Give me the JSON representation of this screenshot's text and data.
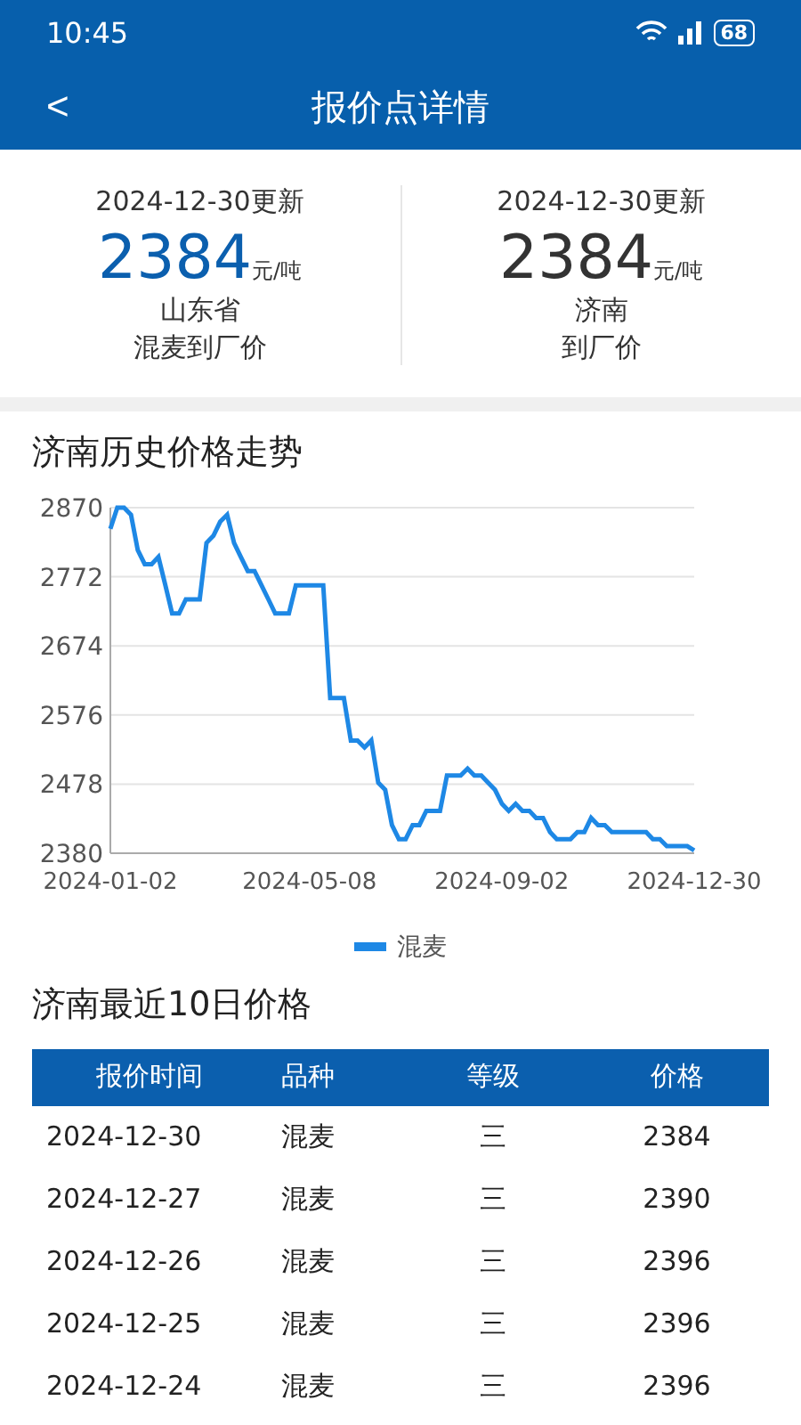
{
  "status_bar": {
    "time": "10:45",
    "battery": "68"
  },
  "header": {
    "back": "<",
    "title": "报价点详情"
  },
  "summary": [
    {
      "updated": "2024-12-30更新",
      "price": "2384",
      "unit": "元/吨",
      "highlight": true,
      "lines": [
        "山东省",
        "混麦到厂价"
      ]
    },
    {
      "updated": "2024-12-30更新",
      "price": "2384",
      "unit": "元/吨",
      "highlight": false,
      "lines": [
        "济南",
        "到厂价"
      ]
    }
  ],
  "history": {
    "title": "济南历史价格走势",
    "chart_data": {
      "type": "line",
      "series": [
        {
          "name": "混麦",
          "color": "#1e88e5",
          "values": [
            2840,
            2870,
            2870,
            2860,
            2810,
            2790,
            2790,
            2800,
            2760,
            2720,
            2720,
            2740,
            2740,
            2740,
            2820,
            2830,
            2850,
            2860,
            2820,
            2800,
            2780,
            2780,
            2760,
            2740,
            2720,
            2720,
            2720,
            2760,
            2760,
            2760,
            2760,
            2760,
            2600,
            2600,
            2600,
            2540,
            2540,
            2530,
            2540,
            2480,
            2470,
            2420,
            2400,
            2400,
            2420,
            2420,
            2440,
            2440,
            2440,
            2490,
            2490,
            2490,
            2500,
            2490,
            2490,
            2480,
            2470,
            2450,
            2440,
            2450,
            2440,
            2440,
            2430,
            2430,
            2410,
            2400,
            2400,
            2400,
            2410,
            2410,
            2430,
            2420,
            2420,
            2410,
            2410,
            2410,
            2410,
            2410,
            2410,
            2400,
            2400,
            2390,
            2390,
            2390,
            2390,
            2384
          ]
        }
      ],
      "ylim": [
        2380,
        2870
      ],
      "yticks": [
        2380,
        2478,
        2576,
        2674,
        2772,
        2870
      ],
      "grid": true,
      "categories": [
        "2024-01-02",
        null,
        null,
        null,
        null,
        null,
        null,
        null,
        null,
        null,
        null,
        null,
        null,
        null,
        null,
        null,
        null,
        null,
        null,
        null,
        null,
        null,
        null,
        null,
        null,
        null,
        null,
        null,
        null,
        "2024-05-08",
        null,
        null,
        null,
        null,
        null,
        null,
        null,
        null,
        null,
        null,
        null,
        null,
        null,
        null,
        null,
        null,
        null,
        null,
        null,
        null,
        null,
        null,
        null,
        null,
        null,
        null,
        null,
        "2024-09-02",
        null,
        null,
        null,
        null,
        null,
        null,
        null,
        null,
        null,
        null,
        null,
        null,
        null,
        null,
        null,
        null,
        null,
        null,
        null,
        null,
        null,
        null,
        null,
        null,
        null,
        null,
        null,
        "2024-12-30"
      ]
    }
  },
  "recent": {
    "title": "济南最近10日价格",
    "columns": [
      "报价时间",
      "品种",
      "等级",
      "价格"
    ],
    "rows": [
      [
        "2024-12-30",
        "混麦",
        "三",
        "2384"
      ],
      [
        "2024-12-27",
        "混麦",
        "三",
        "2390"
      ],
      [
        "2024-12-26",
        "混麦",
        "三",
        "2396"
      ],
      [
        "2024-12-25",
        "混麦",
        "三",
        "2396"
      ],
      [
        "2024-12-24",
        "混麦",
        "三",
        "2396"
      ]
    ]
  }
}
